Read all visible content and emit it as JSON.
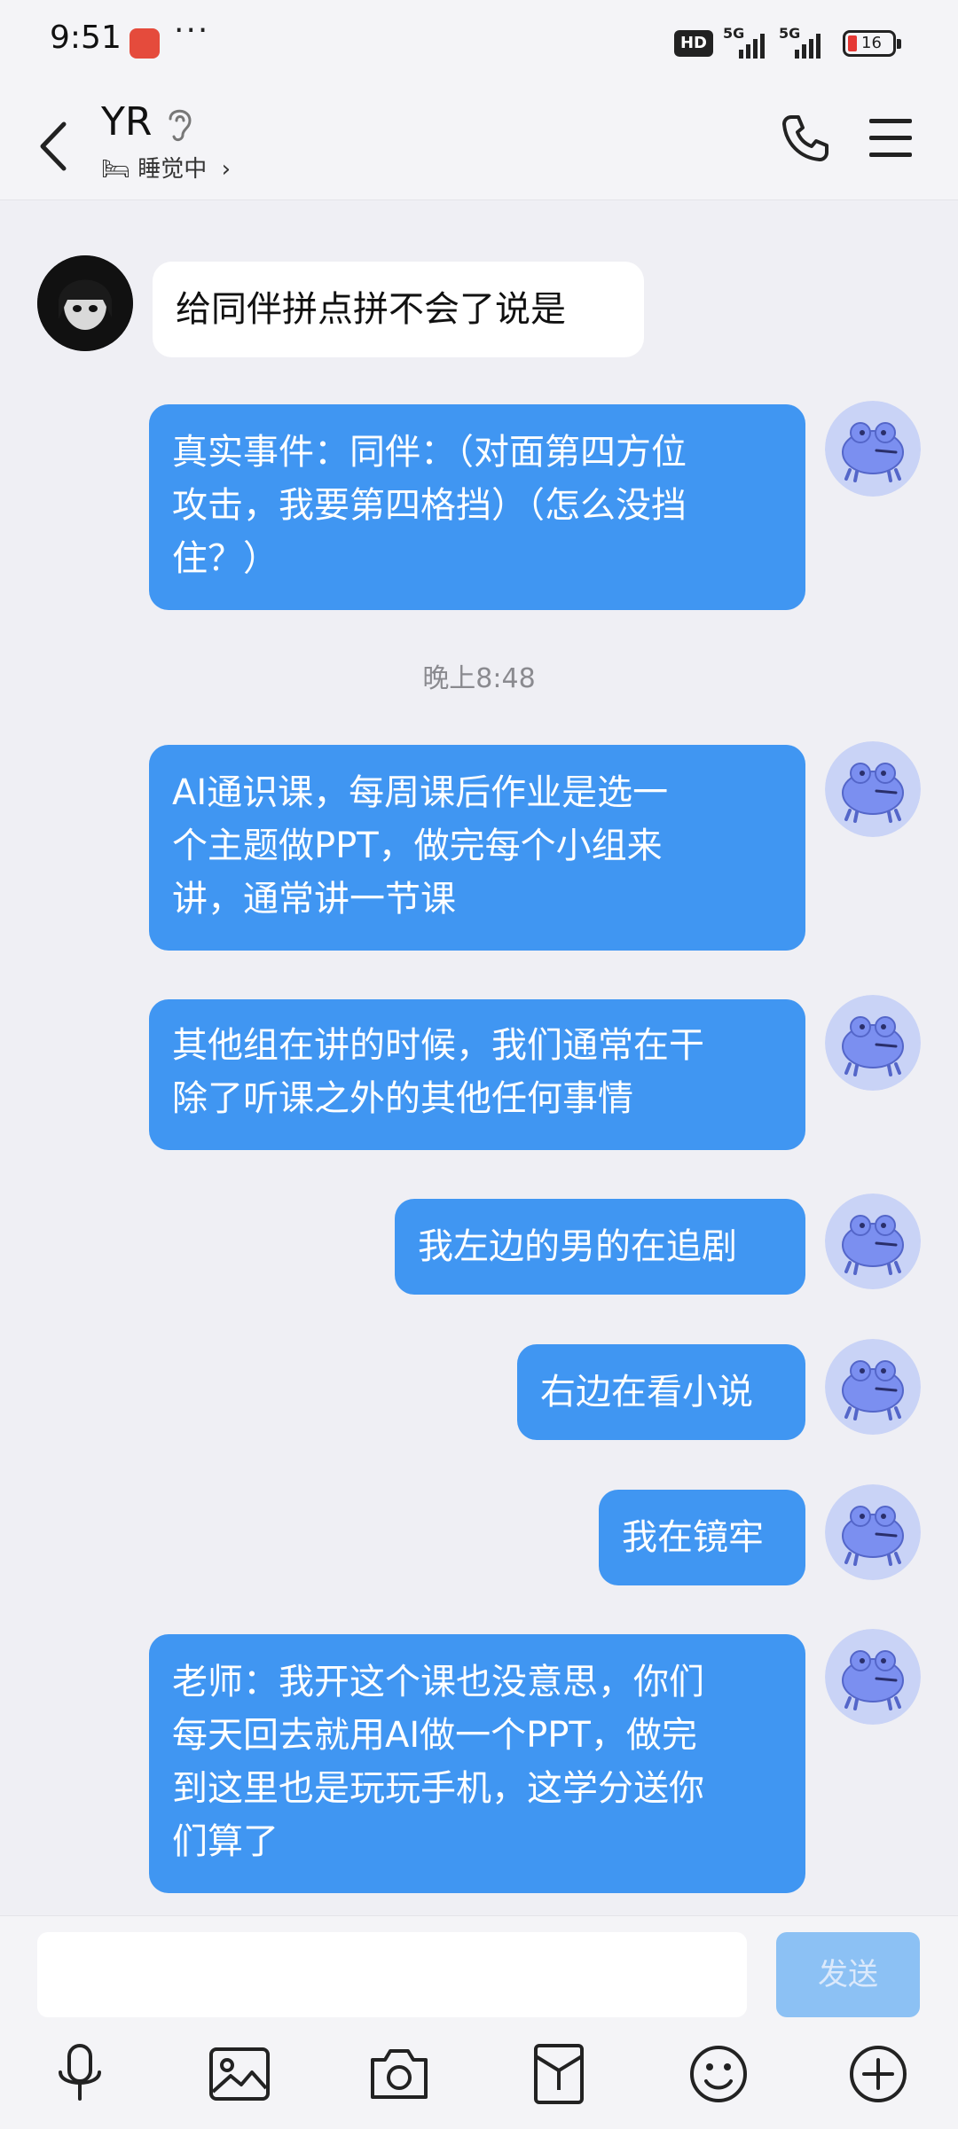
{
  "status_bar": {
    "time": "9:51",
    "hd_label": "HD",
    "signal_labels": [
      "5G",
      "5G"
    ],
    "battery": "16"
  },
  "header": {
    "title": "YR",
    "subtitle": "睡觉中",
    "status_emoji": "🛏"
  },
  "colors": {
    "bubble_self": "#4096f2",
    "bubble_other": "#ffffff",
    "send_disabled": "#8cc1f4",
    "background": "#efeff4"
  },
  "messages": [
    {
      "side": "left",
      "avatar": "dark-avatar",
      "lines": [
        "给同伴拼点拼不会了说是"
      ]
    },
    {
      "side": "right",
      "avatar": "frog-avatar",
      "lines": [
        "真实事件：同伴：（对面第四方位",
        "攻击，我要第四格挡）（怎么没挡",
        "住？）"
      ]
    },
    {
      "side": "time",
      "text": "晚上8:48"
    },
    {
      "side": "right",
      "avatar": "frog-avatar",
      "lines": [
        "AI通识课，每周课后作业是选一",
        "个主题做PPT，做完每个小组来",
        "讲，通常讲一节课"
      ]
    },
    {
      "side": "right",
      "avatar": "frog-avatar",
      "lines": [
        "其他组在讲的时候，我们通常在干",
        "除了听课之外的其他任何事情"
      ]
    },
    {
      "side": "right",
      "avatar": "frog-avatar",
      "lines": [
        "我左边的男的在追剧"
      ]
    },
    {
      "side": "right",
      "avatar": "frog-avatar",
      "lines": [
        "右边在看小说"
      ]
    },
    {
      "side": "right",
      "avatar": "frog-avatar",
      "lines": [
        "我在镜牢"
      ]
    },
    {
      "side": "right",
      "avatar": "frog-avatar",
      "lines": [
        "老师：我开这个课也没意思，你们",
        "每天回去就用AI做一个PPT，做完",
        "到这里也是玩玩手机，这学分送你",
        "们算了"
      ]
    }
  ],
  "composer": {
    "send_label": "发送",
    "input_value": ""
  },
  "toolbar": [
    "microphone-icon",
    "image-icon",
    "camera-icon",
    "red-packet-icon",
    "emoji-icon",
    "plus-icon"
  ]
}
